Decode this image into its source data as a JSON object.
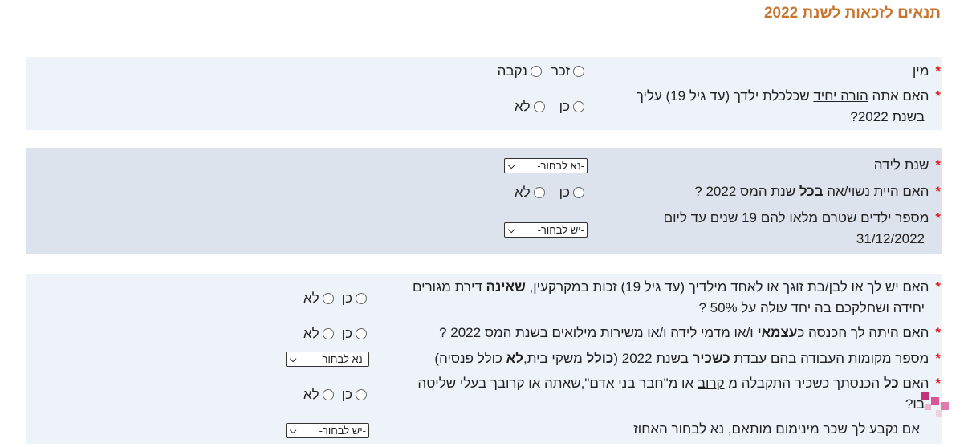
{
  "title": "תנאים לזכאות לשנת 2022",
  "section1": {
    "gender_label": "מין",
    "gender_options": [
      "זכר",
      "נקבה"
    ],
    "single_parent_q_pre": "האם אתה ",
    "single_parent_q_link": "הורה יחיד",
    "single_parent_q_post": " שכלכלת ילדך (עד גיל 19) עליך",
    "single_parent_q_line2": "בשנת 2022?",
    "yes": "כן",
    "no": "לא"
  },
  "section2": {
    "birth_year_label": "שנת לידה",
    "birth_year_select": "-נא לבחור-",
    "married_q_pre": "האם היית נשוי/אה ",
    "married_q_bold": "בכל",
    "married_q_post": " שנת המס 2022 ?",
    "children_q_line1": "מספר ילדים שטרם מלאו להם 19 שנים עד ליום",
    "children_q_line2": "31/12/2022",
    "children_select": "-יש לבחור-",
    "yes": "כן",
    "no": "לא"
  },
  "section3": {
    "realestate_q_pre": "האם יש לך או לבן/בת זוגך או לאחד מילדיך (עד גיל 19) זכות במקרקעין, ",
    "realestate_q_bold": "שאינה",
    "realestate_q_post": " דירת מגורים",
    "realestate_q_line2": "יחידה ושחלקכם בה יחד עולה על 50% ?",
    "income_q_pre": "האם היתה לך הכנסה כ",
    "income_q_bold": "עצמאי",
    "income_q_post": " ו/או מדמי לידה ו/או משירות מילואים בשנת המס 2022 ?",
    "workplaces_q_pre": "מספר מקומות העבודה בהם עבדת ",
    "workplaces_q_bold1": "כשכיר",
    "workplaces_q_mid": " בשנת 2022 (",
    "workplaces_q_bold2": "כולל",
    "workplaces_q_mid2": " משקי בית,",
    "workplaces_q_bold3": "לא",
    "workplaces_q_post": " כולל פנסיה)",
    "workplaces_select": "-נא לבחור-",
    "relative_q_pre": "האם ",
    "relative_q_bold": "כל",
    "relative_q_mid": " הכנסתך כשכיר התקבלה מ ",
    "relative_q_link": "קרוב",
    "relative_q_post": " או מ\"חבר בני אדם\",שאתה או קרובך בעלי שליטה",
    "relative_q_line2": "בו?",
    "minwage_q": "אם נקבע לך שכר מינימום מותאם, נא לבחור האחוז",
    "minwage_select": "-יש לבחור-",
    "yes": "כן",
    "no": "לא"
  },
  "colors": {
    "title": "#c8742e",
    "required_star": "#d22222",
    "panel_light": "#eef3fa",
    "panel_dark": "#dde3ec"
  }
}
